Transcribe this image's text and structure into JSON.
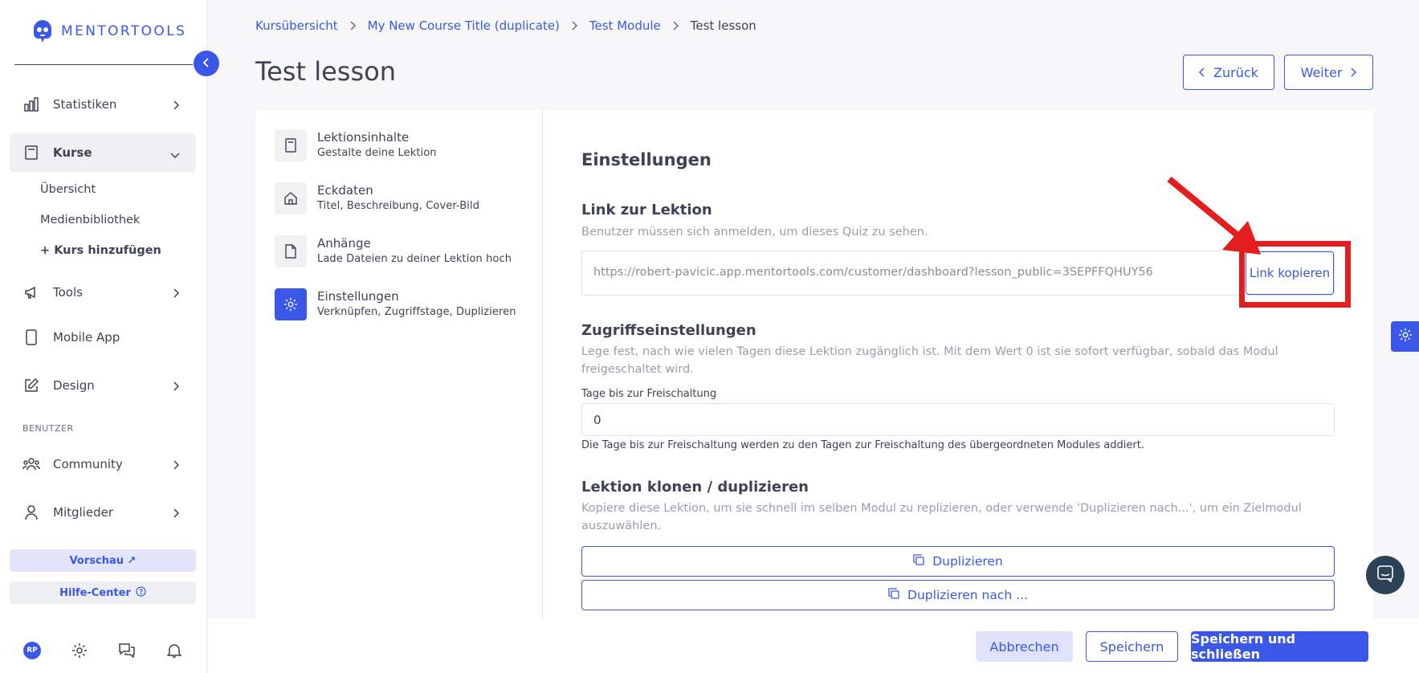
{
  "brand": {
    "name": "MENTORTOOLS"
  },
  "sidebar": {
    "items": [
      {
        "label": "Statistiken",
        "icon": "bar-chart-icon"
      },
      {
        "label": "Kurse",
        "icon": "book-icon"
      },
      {
        "label": "Tools",
        "icon": "megaphone-icon"
      },
      {
        "label": "Mobile App",
        "icon": "smartphone-icon"
      },
      {
        "label": "Design",
        "icon": "edit-icon"
      },
      {
        "label": "Community",
        "icon": "users-icon"
      },
      {
        "label": "Mitglieder",
        "icon": "user-icon"
      }
    ],
    "sub_items": [
      "Übersicht",
      "Medienbibliothek",
      "+ Kurs hinzufügen"
    ],
    "section_label": "BENUTZER",
    "preview_label": "Vorschau ↗",
    "help_label": "Hilfe-Center",
    "avatar_initials": "RP"
  },
  "breadcrumb": [
    "Kursübersicht",
    "My New Course Title (duplicate)",
    "Test Module",
    "Test lesson"
  ],
  "page": {
    "title": "Test lesson",
    "back_label": "Zurück",
    "next_label": "Weiter"
  },
  "tabs": [
    {
      "title": "Lektionsinhalte",
      "subtitle": "Gestalte deine Lektion",
      "icon": "book-icon"
    },
    {
      "title": "Eckdaten",
      "subtitle": "Titel, Beschreibung, Cover-Bild",
      "icon": "home-icon"
    },
    {
      "title": "Anhänge",
      "subtitle": "Lade Dateien zu deiner Lektion hoch",
      "icon": "file-icon"
    },
    {
      "title": "Einstellungen",
      "subtitle": "Verknüpfen, Zugriffstage, Duplizieren",
      "icon": "gear-icon"
    }
  ],
  "settings": {
    "heading": "Einstellungen",
    "link": {
      "heading": "Link zur Lektion",
      "description": "Benutzer müssen sich anmelden, um dieses Quiz zu sehen.",
      "url": "https://robert-pavicic.app.mentortools.com/customer/dashboard?lesson_public=3SEPFFQHUY56",
      "copy_label": "Link kopieren"
    },
    "access": {
      "heading": "Zugriffseinstellungen",
      "description": "Lege fest, nach wie vielen Tagen diese Lektion zugänglich ist. Mit dem Wert 0 ist sie sofort verfügbar, sobald das Modul freigeschaltet wird.",
      "field_label": "Tage bis zur Freischaltung",
      "field_value": "0",
      "hint": "Die Tage bis zur Freischaltung werden zu den Tagen zur Freischaltung des übergeordneten Modules addiert."
    },
    "clone": {
      "heading": "Lektion klonen / duplizieren",
      "description": "Kopiere diese Lektion, um sie schnell im selben Modul zu replizieren, oder verwende 'Duplizieren nach...', um ein Zielmodul auszuwählen.",
      "duplicate_label": "Duplizieren",
      "duplicate_to_label": "Duplizieren nach ..."
    }
  },
  "footer": {
    "cancel_label": "Abbrechen",
    "save_label": "Speichern",
    "save_close_label": "Speichern und schließen"
  },
  "colors": {
    "accent": "#3a57e8",
    "highlight": "#e41e1e"
  }
}
